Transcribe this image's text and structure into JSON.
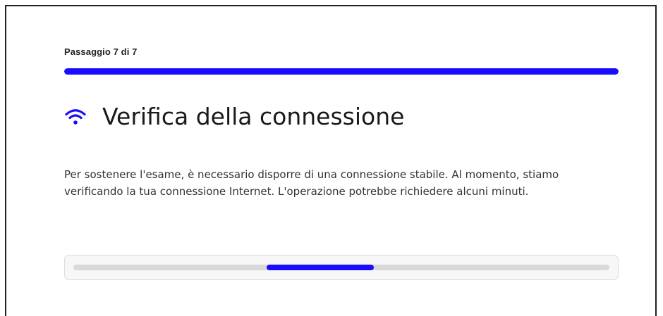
{
  "step": {
    "label": "Passaggio 7 di 7",
    "current": 7,
    "total": 7,
    "progress_fraction": 1.0
  },
  "heading": {
    "icon": "wifi-icon",
    "title": "Verifica della connessione"
  },
  "description": "Per sostenere l'esame, è necessario disporre di una connessione stabile. Al momento, stiamo verificando la tua connessione Internet. L'operazione potrebbe richiedere alcuni minuti.",
  "connection_check": {
    "state": "indeterminate",
    "indicator_start_fraction": 0.36,
    "indicator_length_fraction": 0.2
  },
  "colors": {
    "accent": "#1a0dff",
    "track": "#d9d9d9",
    "border": "#222222"
  }
}
